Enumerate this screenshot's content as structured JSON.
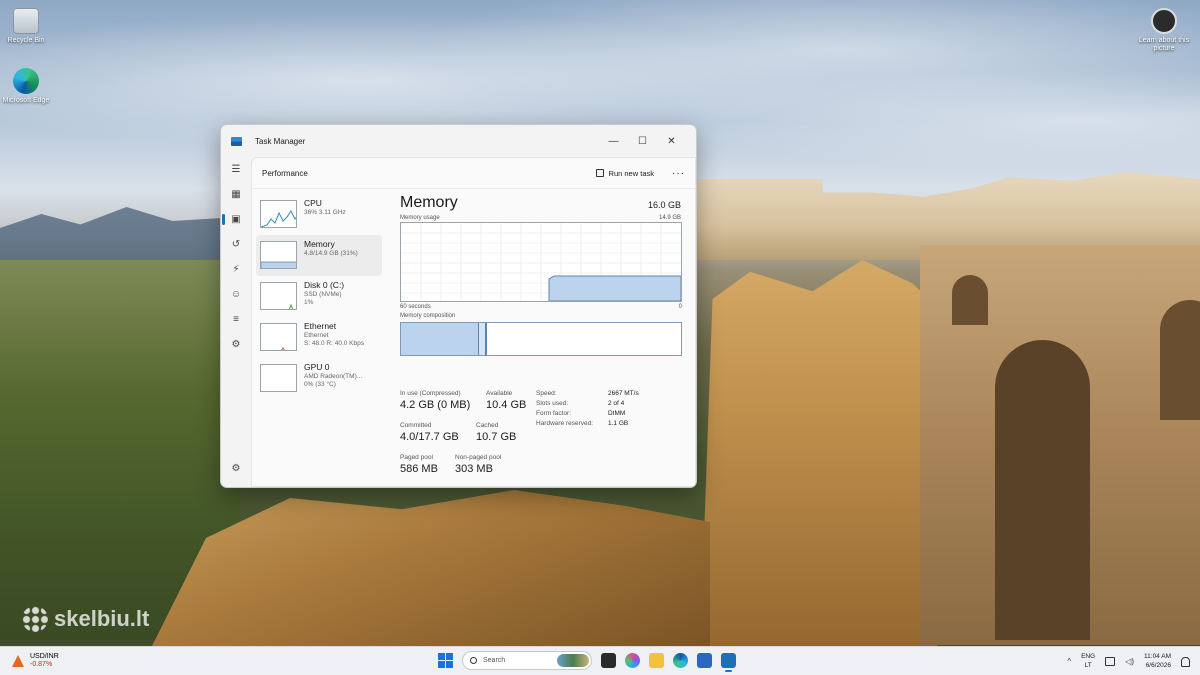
{
  "desktop": {
    "icons": [
      {
        "label": "Recycle Bin"
      },
      {
        "label": "Microsoft Edge"
      },
      {
        "label": "Learn about this picture"
      }
    ],
    "watermark": "skelbiu.lt"
  },
  "task_manager": {
    "title": "Task Manager",
    "window_controls": {
      "minimize": "—",
      "maximize": "☐",
      "close": "✕"
    },
    "page": "Performance",
    "run_new_task": "Run new task",
    "more": "···",
    "perf_list": [
      {
        "name": "CPU",
        "line1": "36% 3.11 GHz",
        "line2": ""
      },
      {
        "name": "Memory",
        "line1": "4.8/14.9 GB (31%)",
        "line2": ""
      },
      {
        "name": "Disk 0 (C:)",
        "line1": "SSD (NVMe)",
        "line2": "1%"
      },
      {
        "name": "Ethernet",
        "line1": "Ethernet",
        "line2": "S: 48.0 R: 40.0 Kbps"
      },
      {
        "name": "GPU 0",
        "line1": "AMD Radeon(TM)...",
        "line2": "0% (33 °C)"
      }
    ],
    "memory": {
      "title": "Memory",
      "total": "16.0 GB",
      "usage_label": "Memory usage",
      "usage_max": "14.9 GB",
      "axis_left": "60 seconds",
      "axis_right": "0",
      "composition_label": "Memory composition",
      "in_use_fraction": 0.28,
      "stats": {
        "in_use_label": "In use (Compressed)",
        "in_use_value": "4.2 GB (0 MB)",
        "available_label": "Available",
        "available_value": "10.4 GB",
        "committed_label": "Committed",
        "committed_value": "4.0/17.7 GB",
        "cached_label": "Cached",
        "cached_value": "10.7 GB",
        "paged_label": "Paged pool",
        "paged_value": "586 MB",
        "nonpaged_label": "Non-paged pool",
        "nonpaged_value": "303 MB"
      },
      "specs": [
        {
          "key": "Speed:",
          "value": "2667 MT/s"
        },
        {
          "key": "Slots used:",
          "value": "2 of 4"
        },
        {
          "key": "Form factor:",
          "value": "DIMM"
        },
        {
          "key": "Hardware reserved:",
          "value": "1.1 GB"
        }
      ]
    }
  },
  "taskbar": {
    "widget": {
      "label": "USD/INR",
      "change": "-0.87%"
    },
    "search_placeholder": "Search",
    "chevron": "^",
    "language": {
      "line1": "ENG",
      "line2": "LT"
    },
    "time": "11:04 AM",
    "date": "6/6/2026"
  },
  "colors": {
    "accent": "#1e6fb5",
    "memory_fill": "#bcd3ee",
    "memory_stroke": "#5e84ad",
    "negative": "#c42b1c"
  }
}
